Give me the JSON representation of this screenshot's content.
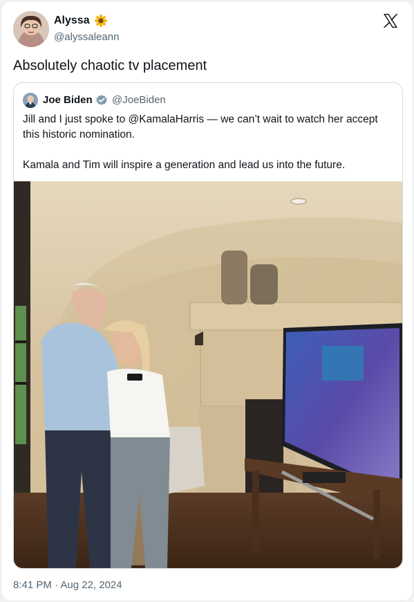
{
  "author": {
    "display_name": "Alyssa",
    "emoji_icon": "sunflower-icon",
    "handle": "@alyssaleann"
  },
  "tweet": {
    "text": "Absolutely chaotic tv placement",
    "timestamp": "8:41 PM · Aug 22, 2024"
  },
  "quoted": {
    "display_name": "Joe Biden",
    "badge_icon": "verified-badge-icon",
    "handle": "@JoeBiden",
    "paragraphs": [
      "Jill and I just spoke to @KamalaHarris — we can’t wait to watch her accept this historic nomination.",
      "Kamala and Tim will inspire a generation and lead us into the future."
    ],
    "photo_icon": "photo"
  },
  "brand": {
    "logo_icon": "x-logo-icon",
    "text_color": "#0f1419",
    "muted_color": "#536471",
    "border_color": "#cfd9de"
  }
}
